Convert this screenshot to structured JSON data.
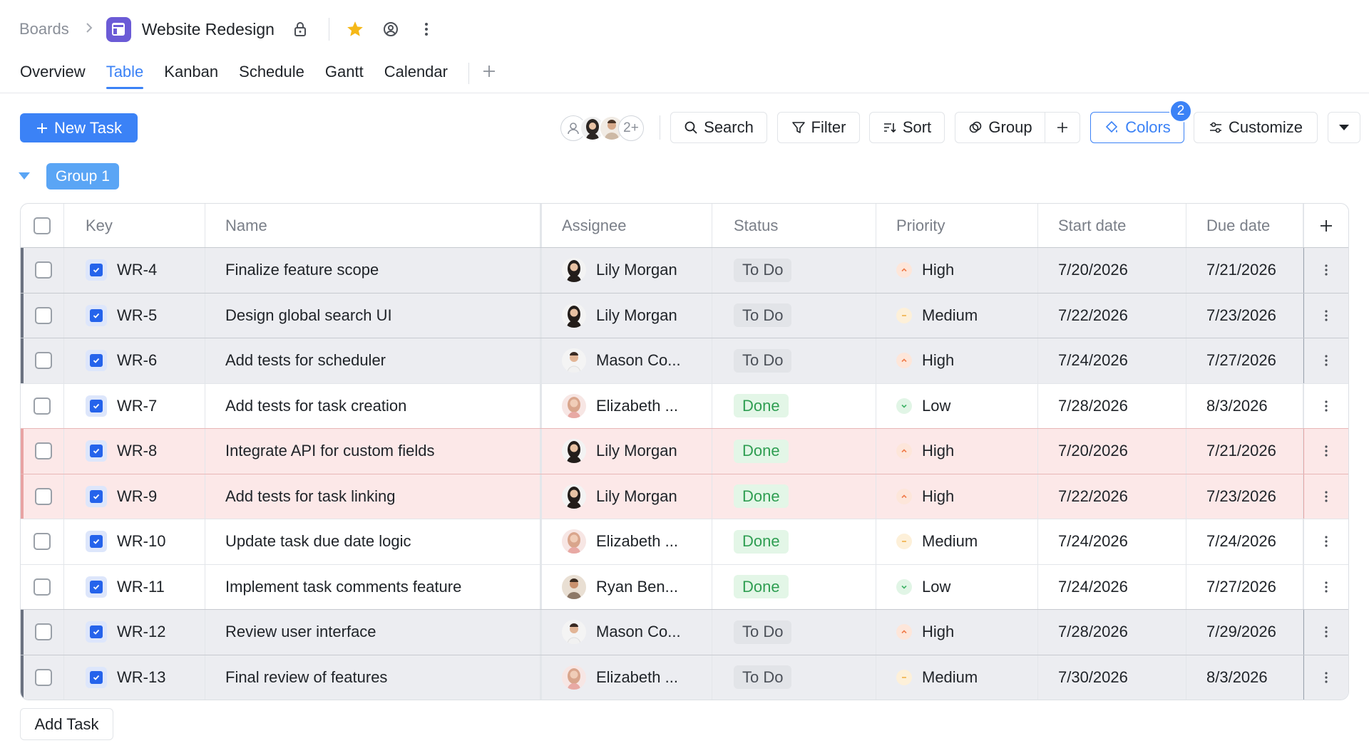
{
  "breadcrumb": {
    "root": "Boards",
    "title": "Website Redesign"
  },
  "tabs": [
    {
      "label": "Overview",
      "active": false
    },
    {
      "label": "Table",
      "active": true
    },
    {
      "label": "Kanban",
      "active": false
    },
    {
      "label": "Schedule",
      "active": false
    },
    {
      "label": "Gantt",
      "active": false
    },
    {
      "label": "Calendar",
      "active": false
    }
  ],
  "toolbar": {
    "new_task": "New Task",
    "avatars_more": "2+",
    "search": "Search",
    "filter": "Filter",
    "sort": "Sort",
    "group": "Group",
    "colors": "Colors",
    "colors_badge": "2",
    "customize": "Customize"
  },
  "group": {
    "label": "Group 1"
  },
  "columns": {
    "key": "Key",
    "name": "Name",
    "assignee": "Assignee",
    "status": "Status",
    "priority": "Priority",
    "start": "Start date",
    "due": "Due date"
  },
  "rows": [
    {
      "key": "WR-4",
      "name": "Finalize feature scope",
      "assignee": "Lily Morgan",
      "status": "To Do",
      "priority": "High",
      "start": "7/20/2026",
      "due": "7/21/2026"
    },
    {
      "key": "WR-5",
      "name": "Design global search UI",
      "assignee": "Lily Morgan",
      "status": "To Do",
      "priority": "Medium",
      "start": "7/22/2026",
      "due": "7/23/2026"
    },
    {
      "key": "WR-6",
      "name": "Add tests for scheduler",
      "assignee": "Mason Co...",
      "status": "To Do",
      "priority": "High",
      "start": "7/24/2026",
      "due": "7/27/2026"
    },
    {
      "key": "WR-7",
      "name": "Add tests for task creation",
      "assignee": "Elizabeth ...",
      "status": "Done",
      "priority": "Low",
      "start": "7/28/2026",
      "due": "8/3/2026"
    },
    {
      "key": "WR-8",
      "name": "Integrate API for custom fields",
      "assignee": "Lily Morgan",
      "status": "Done",
      "priority": "High",
      "start": "7/20/2026",
      "due": "7/21/2026"
    },
    {
      "key": "WR-9",
      "name": "Add tests for task linking",
      "assignee": "Lily Morgan",
      "status": "Done",
      "priority": "High",
      "start": "7/22/2026",
      "due": "7/23/2026"
    },
    {
      "key": "WR-10",
      "name": "Update task due date logic",
      "assignee": "Elizabeth ...",
      "status": "Done",
      "priority": "Medium",
      "start": "7/24/2026",
      "due": "7/24/2026"
    },
    {
      "key": "WR-11",
      "name": "Implement task comments feature",
      "assignee": "Ryan Ben...",
      "status": "Done",
      "priority": "Low",
      "start": "7/24/2026",
      "due": "7/27/2026"
    },
    {
      "key": "WR-12",
      "name": "Review user interface",
      "assignee": "Mason Co...",
      "status": "To Do",
      "priority": "High",
      "start": "7/28/2026",
      "due": "7/29/2026"
    },
    {
      "key": "WR-13",
      "name": "Final review of features",
      "assignee": "Elizabeth ...",
      "status": "To Do",
      "priority": "Medium",
      "start": "7/30/2026",
      "due": "8/3/2026"
    }
  ],
  "footer": {
    "add_task": "Add Task"
  },
  "colors": {
    "accent": "#3b82f6",
    "row_gray": "#ecedf1",
    "row_red": "#fce8e8",
    "done": "#2f9e52"
  }
}
